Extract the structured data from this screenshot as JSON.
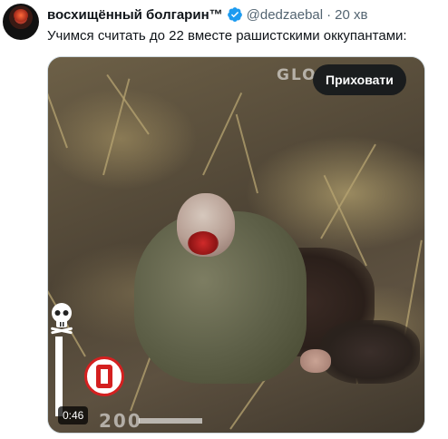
{
  "tweet": {
    "author_name": "восхищённый болгарин™",
    "handle": "@dedzaebal",
    "separator": "·",
    "time": "20 хв",
    "text": "Учимся считать до 22 вместе рашистскими оккупантами:"
  },
  "media": {
    "watermark": "GLO",
    "hide_button_label": "Приховати",
    "duration": "0:46",
    "counter_text": "200"
  },
  "icons": {
    "verified": "verified-badge-icon",
    "skull": "skull-icon",
    "channel_logo": "channel-logo-icon"
  },
  "colors": {
    "verified": "#1d9bf0",
    "text_primary": "#0f1419",
    "text_secondary": "#536471",
    "logo_red": "#d42020"
  }
}
